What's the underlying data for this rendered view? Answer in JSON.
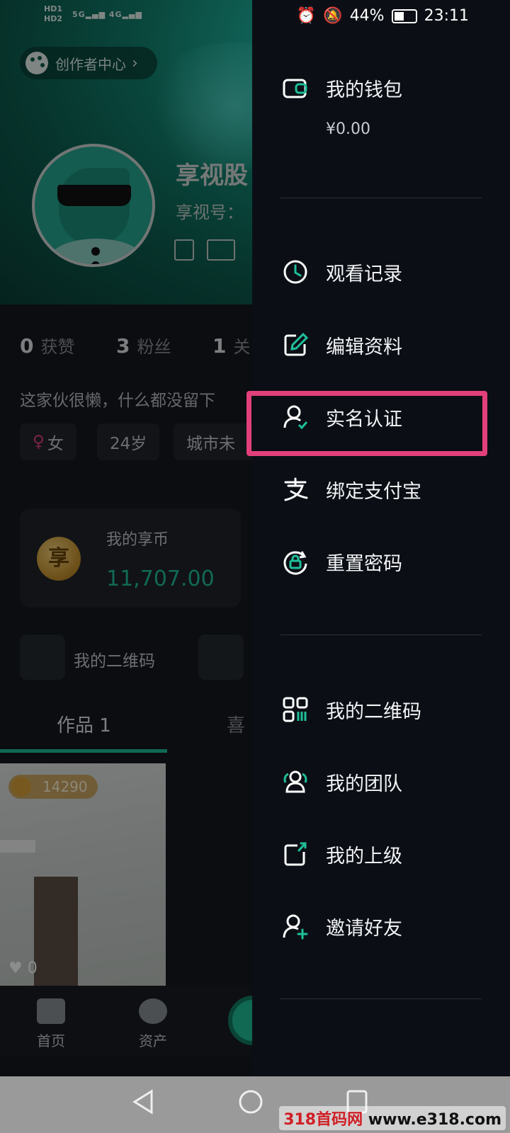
{
  "status_bar": {
    "left_indicators": [
      "HD1",
      "HD2",
      "5G",
      "4G"
    ],
    "battery": "44%",
    "time": "23:11",
    "icons": [
      "alarm-icon",
      "mute-icon",
      "battery-icon"
    ]
  },
  "profile": {
    "creator_center": "创作者中心",
    "nickname": "享视股",
    "user_id_label": "享视号：",
    "stats": [
      {
        "count": "0",
        "label": "获赞"
      },
      {
        "count": "3",
        "label": "粉丝"
      },
      {
        "count": "1",
        "label": "关"
      }
    ],
    "bio": "这家伙很懒，什么都没留下",
    "tags": [
      "女",
      "24岁",
      "城市未"
    ],
    "coin_card": {
      "label": "我的享币",
      "value": "11,707.00",
      "icon_glyph": "享"
    },
    "qr_label": "我的二维码",
    "tabs": {
      "works": "作品 1",
      "likes": "喜"
    },
    "video": {
      "price": "14290",
      "likes": "0"
    },
    "bottom_nav": [
      {
        "label": "首页",
        "icon": "home-icon"
      },
      {
        "label": "资产",
        "icon": "money-bag-icon"
      }
    ]
  },
  "drawer": {
    "wallet": {
      "label": "我的钱包",
      "amount": "¥0.00",
      "icon": "wallet-icon"
    },
    "group1": [
      {
        "label": "观看记录",
        "icon": "clock-icon"
      },
      {
        "label": "编辑资料",
        "icon": "edit-icon"
      },
      {
        "label": "实名认证",
        "icon": "user-verify-icon"
      },
      {
        "label": "绑定支付宝",
        "icon": "alipay-icon"
      },
      {
        "label": "重置密码",
        "icon": "reset-lock-icon"
      }
    ],
    "group2": [
      {
        "label": "我的二维码",
        "icon": "qr-code-icon"
      },
      {
        "label": "我的团队",
        "icon": "team-icon"
      },
      {
        "label": "我的上级",
        "icon": "superior-icon"
      },
      {
        "label": "邀请好友",
        "icon": "invite-friend-icon"
      }
    ]
  },
  "colors": {
    "accent": "#1fbf9a",
    "highlight": "#e2407a",
    "drawer_bg": "#0b0f15"
  },
  "watermark": {
    "part1": "318首码网",
    "part2": "www.e318.com"
  }
}
